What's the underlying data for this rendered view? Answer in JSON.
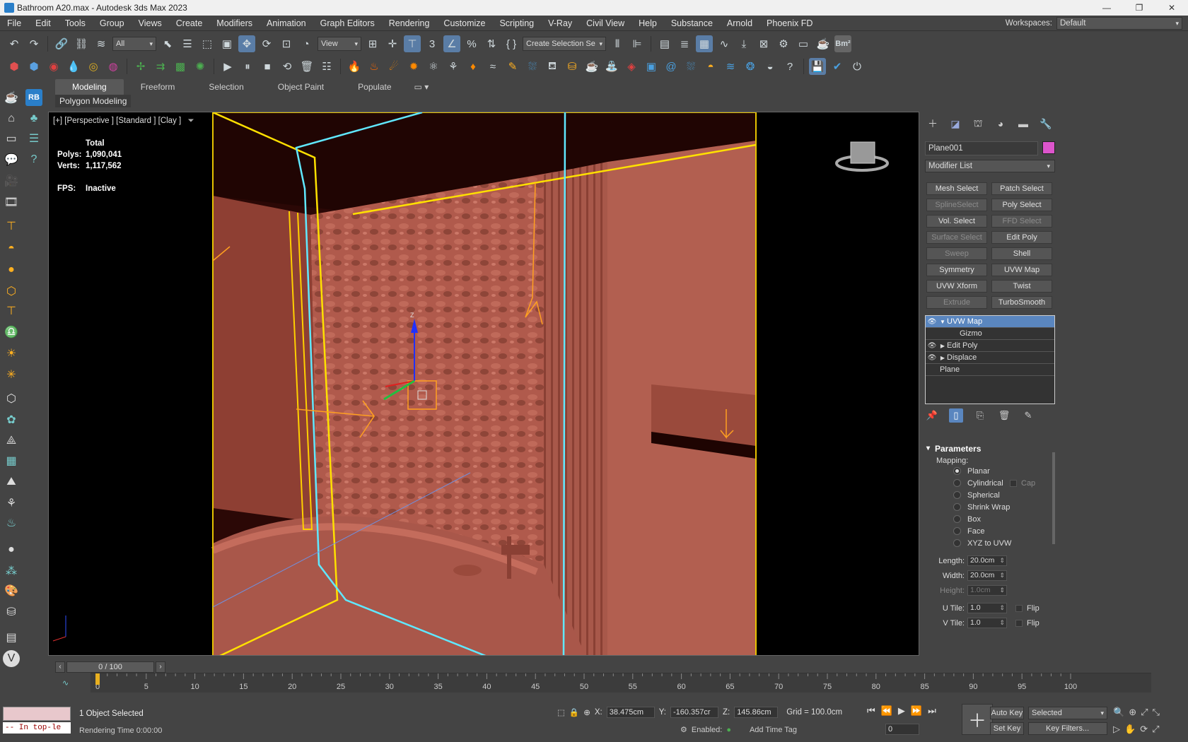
{
  "window": {
    "title": "Bathroom A20.max - Autodesk 3ds Max 2023",
    "controls": [
      "—",
      "❐",
      "✕"
    ]
  },
  "menu": [
    "File",
    "Edit",
    "Tools",
    "Group",
    "Views",
    "Create",
    "Modifiers",
    "Animation",
    "Graph Editors",
    "Rendering",
    "Customize",
    "Scripting",
    "V-Ray",
    "Civil View",
    "Help",
    "Substance",
    "Arnold",
    "Phoenix FD"
  ],
  "workspace": {
    "label": "Workspaces:",
    "value": "Default"
  },
  "toolbar": {
    "filter_value": "All",
    "view_value": "View",
    "selection_set_value": "Create Selection Se",
    "bm2_label": "Bm²"
  },
  "ribbon": {
    "tabs": [
      "Modeling",
      "Freeform",
      "Selection",
      "Object Paint",
      "Populate"
    ],
    "active_panel": "Polygon Modeling"
  },
  "viewport": {
    "label": "[+] [Perspective ] [Standard ] [Clay ]",
    "stats_header": "Total",
    "polys_label": "Polys:",
    "polys_value": "1,090,041",
    "verts_label": "Verts:",
    "verts_value": "1,117,562",
    "fps_label": "FPS:",
    "fps_value": "Inactive",
    "gizmo_z": "Z"
  },
  "command_panel": {
    "object_name": "Plane001",
    "object_color": "#dd55cc",
    "modifier_list": "Modifier List",
    "modifier_buttons": [
      {
        "label": "Mesh Select",
        "enabled": true
      },
      {
        "label": "Patch Select",
        "enabled": true
      },
      {
        "label": "SplineSelect",
        "enabled": false
      },
      {
        "label": "Poly Select",
        "enabled": true
      },
      {
        "label": "Vol. Select",
        "enabled": true
      },
      {
        "label": "FFD Select",
        "enabled": false
      },
      {
        "label": "Surface Select",
        "enabled": false
      },
      {
        "label": "Edit Poly",
        "enabled": true
      },
      {
        "label": "Sweep",
        "enabled": false
      },
      {
        "label": "Shell",
        "enabled": true
      },
      {
        "label": "Symmetry",
        "enabled": true
      },
      {
        "label": "UVW Map",
        "enabled": true
      },
      {
        "label": "UVW Xform",
        "enabled": true
      },
      {
        "label": "Twist",
        "enabled": true
      },
      {
        "label": "Extrude",
        "enabled": false
      },
      {
        "label": "TurboSmooth",
        "enabled": true
      }
    ],
    "stack": [
      {
        "label": "UVW Map",
        "selected": true
      },
      {
        "label": "Gizmo",
        "selected": false
      },
      {
        "label": "Edit Poly",
        "selected": false
      },
      {
        "label": "Displace",
        "selected": false
      },
      {
        "label": "Plane",
        "selected": false
      }
    ],
    "parameters": {
      "title": "Parameters",
      "mapping_label": "Mapping:",
      "mapping_options": [
        "Planar",
        "Cylindrical",
        "Spherical",
        "Shrink Wrap",
        "Box",
        "Face",
        "XYZ to UVW"
      ],
      "mapping_selected": "Planar",
      "cap_label": "Cap",
      "length_label": "Length:",
      "length_value": "20.0cm",
      "width_label": "Width:",
      "width_value": "20.0cm",
      "height_label": "Height:",
      "height_value": "1.0cm",
      "utile_label": "U Tile:",
      "utile_value": "1.0",
      "vtile_label": "V Tile:",
      "vtile_value": "1.0",
      "flip_label": "Flip"
    }
  },
  "timeline": {
    "frame_display": "0 / 100",
    "ticks": [
      "0",
      "5",
      "10",
      "15",
      "20",
      "25",
      "30",
      "35",
      "40",
      "45",
      "50",
      "55",
      "60",
      "65",
      "70",
      "75",
      "80",
      "85",
      "90",
      "95",
      "100"
    ]
  },
  "status": {
    "selection_text": "1 Object Selected",
    "render_time": "Rendering Time  0:00:00",
    "maxscript_text": "-- In top-le",
    "x_label": "X:",
    "x_value": "38.475cm",
    "y_label": "Y:",
    "y_value": "-160.357cr",
    "z_label": "Z:",
    "z_value": "145.86cm",
    "grid_text": "Grid = 100.0cm",
    "enabled_text": "Enabled:",
    "add_time_tag": "Add Time Tag",
    "frame_value": "0",
    "autokey": "Auto Key",
    "setkey": "Set Key",
    "selected_value": "Selected",
    "key_filters": "Key Filters..."
  }
}
